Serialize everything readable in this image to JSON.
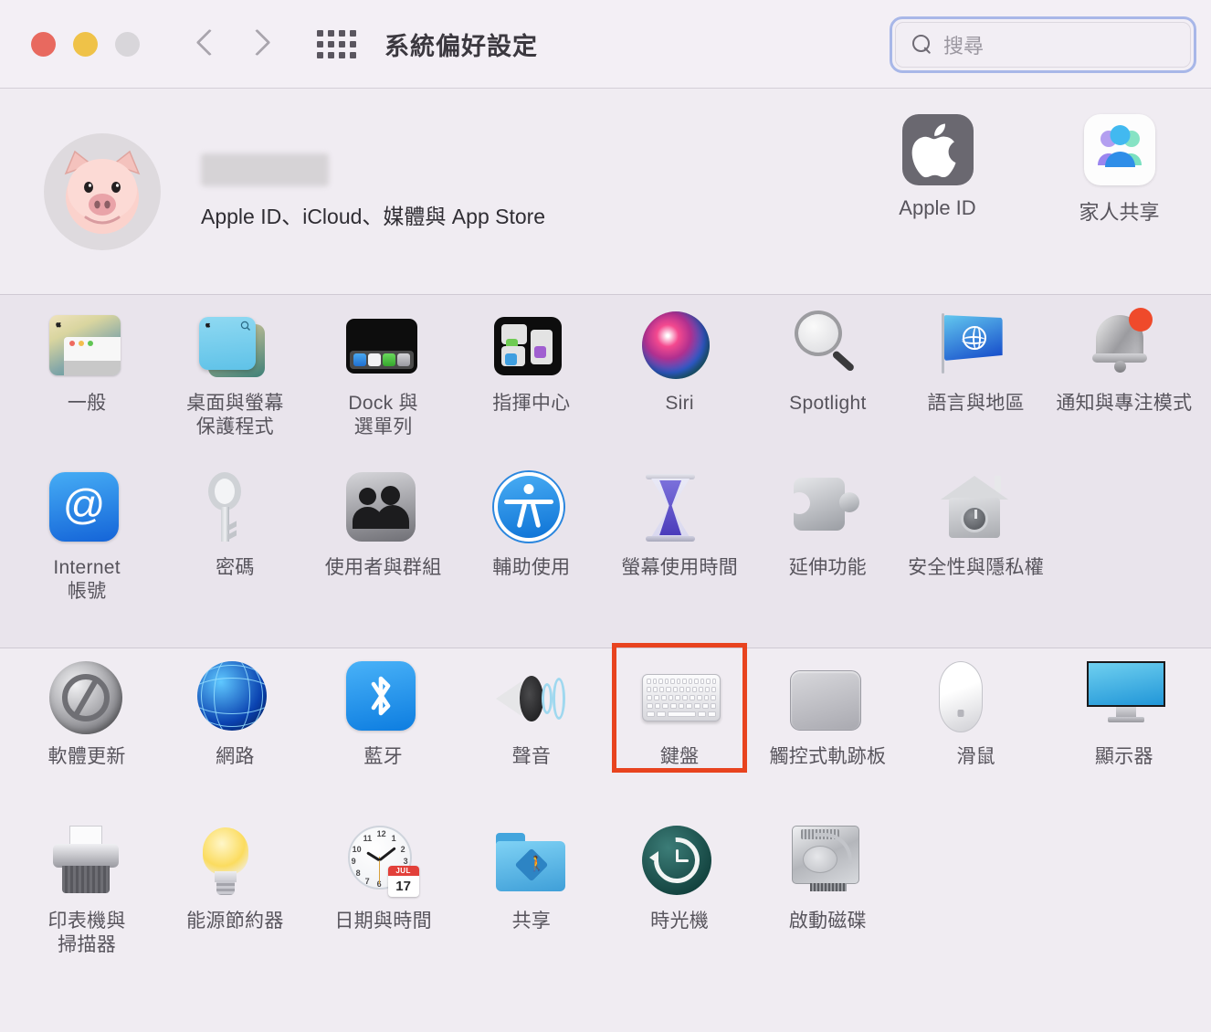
{
  "window": {
    "title": "系統偏好設定",
    "traffic_lights": [
      "close",
      "minimize",
      "zoom"
    ],
    "nav_back": "back-chevron",
    "nav_forward": "forward-chevron",
    "grid_button": "show-all-grid"
  },
  "search": {
    "placeholder": "搜尋",
    "value": "",
    "icon": "search-icon",
    "focused": true,
    "focus_ring_color": "#a8b7e8"
  },
  "account": {
    "avatar": "pig-memoji-avatar",
    "name_redacted": true,
    "subtitle": "Apple ID、iCloud、媒體與 App Store",
    "tiles": [
      {
        "label": "Apple ID",
        "icon": "apple-logo-icon"
      },
      {
        "label": "家人共享",
        "icon": "family-sharing-icon"
      }
    ]
  },
  "highlight": {
    "target": "鍵盤",
    "border_color": "#e8431f"
  },
  "sections": [
    {
      "id": "personal",
      "items": [
        {
          "label": "一般",
          "icon": "general-icon",
          "highlighted": false
        },
        {
          "label": "桌面與螢幕\n保護程式",
          "icon": "desktop-screensaver-icon",
          "highlighted": false
        },
        {
          "label": "Dock 與\n選單列",
          "icon": "dock-menubar-icon",
          "highlighted": false
        },
        {
          "label": "指揮中心",
          "icon": "mission-control-icon",
          "highlighted": false
        },
        {
          "label": "Siri",
          "icon": "siri-icon",
          "highlighted": false
        },
        {
          "label": "Spotlight",
          "icon": "spotlight-icon",
          "highlighted": false
        },
        {
          "label": "語言與地區",
          "icon": "language-region-icon",
          "highlighted": false
        },
        {
          "label": "通知與專注模式",
          "icon": "notifications-focus-icon",
          "highlighted": false
        },
        {
          "label": "Internet\n帳號",
          "icon": "internet-accounts-icon",
          "highlighted": false
        },
        {
          "label": "密碼",
          "icon": "passwords-key-icon",
          "highlighted": false
        },
        {
          "label": "使用者與群組",
          "icon": "users-groups-icon",
          "highlighted": false
        },
        {
          "label": "輔助使用",
          "icon": "accessibility-icon",
          "highlighted": false
        },
        {
          "label": "螢幕使用時間",
          "icon": "screen-time-icon",
          "highlighted": false
        },
        {
          "label": "延伸功能",
          "icon": "extensions-puzzle-icon",
          "highlighted": false
        },
        {
          "label": "安全性與隱私權",
          "icon": "security-privacy-icon",
          "highlighted": false
        }
      ]
    },
    {
      "id": "hardware",
      "items": [
        {
          "label": "軟體更新",
          "icon": "software-update-icon",
          "highlighted": false
        },
        {
          "label": "網路",
          "icon": "network-globe-icon",
          "highlighted": false
        },
        {
          "label": "藍牙",
          "icon": "bluetooth-icon",
          "highlighted": false
        },
        {
          "label": "聲音",
          "icon": "sound-icon",
          "highlighted": false
        },
        {
          "label": "鍵盤",
          "icon": "keyboard-icon",
          "highlighted": true
        },
        {
          "label": "觸控式軌跡板",
          "icon": "trackpad-icon",
          "highlighted": false
        },
        {
          "label": "滑鼠",
          "icon": "mouse-icon",
          "highlighted": false
        },
        {
          "label": "顯示器",
          "icon": "displays-icon",
          "highlighted": false
        },
        {
          "label": "印表機與\n掃描器",
          "icon": "printers-scanners-icon",
          "highlighted": false
        },
        {
          "label": "能源節約器",
          "icon": "energy-saver-icon",
          "highlighted": false
        },
        {
          "label": "日期與時間",
          "icon": "date-time-icon",
          "highlighted": false
        },
        {
          "label": "共享",
          "icon": "sharing-icon",
          "highlighted": false
        },
        {
          "label": "時光機",
          "icon": "time-machine-icon",
          "highlighted": false
        },
        {
          "label": "啟動磁碟",
          "icon": "startup-disk-icon",
          "highlighted": false
        }
      ]
    }
  ],
  "date_time_icon": {
    "month": "JUL",
    "day": "17"
  }
}
